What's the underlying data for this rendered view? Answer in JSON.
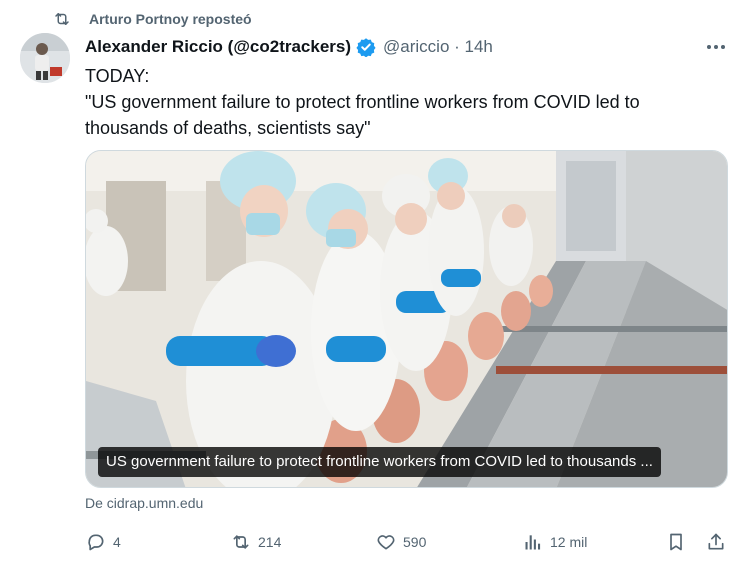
{
  "repost": {
    "text": "Arturo Portnoy reposteó"
  },
  "tweet": {
    "author_name": "Alexander Riccio (@co2trackers)",
    "handle_time": "@ariccio · 14h",
    "text_line1": "TODAY:",
    "text_line2": "\"US government failure to protect frontline workers from COVID led to thousands of deaths, scientists say\""
  },
  "card": {
    "caption": "US government failure to protect frontline workers from COVID led to thousands ...",
    "source": "De cidrap.umn.edu"
  },
  "actions": {
    "replies": "4",
    "reposts": "214",
    "likes": "590",
    "views": "12 mil"
  },
  "icons": {
    "repost": "repost-icon",
    "verified": "verified-badge-icon",
    "more": "more-icon",
    "reply": "reply-icon",
    "like": "heart-icon",
    "views": "views-icon",
    "bookmark": "bookmark-icon",
    "share": "share-icon"
  },
  "colors": {
    "verified": "#1d9bf0",
    "secondary_text": "#536471",
    "primary_text": "#0f1419"
  }
}
